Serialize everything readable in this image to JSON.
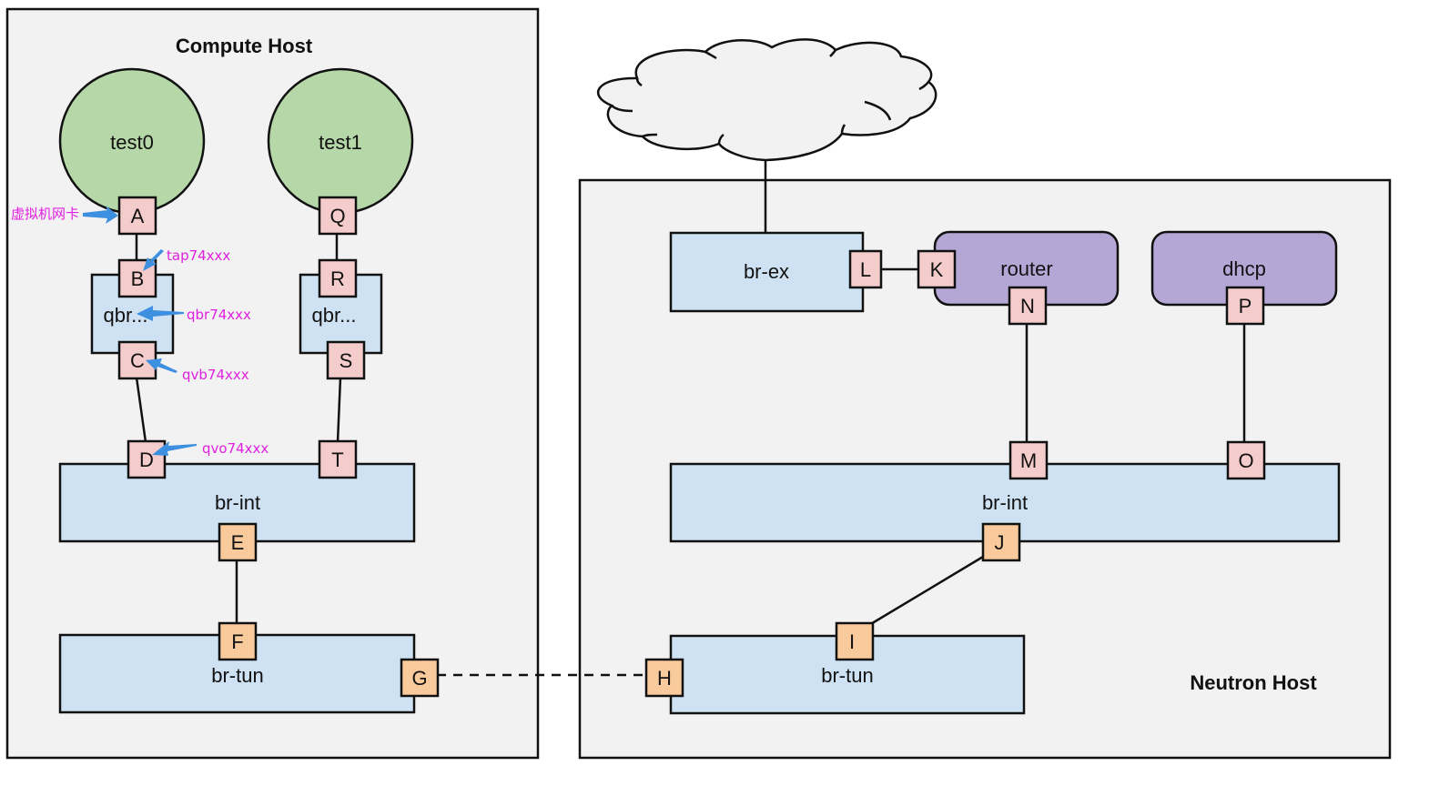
{
  "compute_host": {
    "title": "Compute Host",
    "vms": [
      {
        "name": "test0",
        "port": "A"
      },
      {
        "name": "test1",
        "port": "Q"
      }
    ],
    "qbr_bridges": [
      {
        "label": "qbr...",
        "top_port": "B",
        "bottom_port": "C"
      },
      {
        "label": "qbr...",
        "top_port": "R",
        "bottom_port": "S"
      }
    ],
    "br_int": {
      "label": "br-int",
      "ports": [
        "D",
        "T",
        "E"
      ]
    },
    "br_tun": {
      "label": "br-tun",
      "ports": [
        "F",
        "G"
      ]
    },
    "annotations": [
      {
        "text": "虚拟机网卡",
        "target": "A"
      },
      {
        "text": "tap74xxx",
        "target": "B"
      },
      {
        "text": "qbr74xxx",
        "target": "qbr"
      },
      {
        "text": "qvb74xxx",
        "target": "C"
      },
      {
        "text": "qvo74xxx",
        "target": "D"
      }
    ]
  },
  "neutron_host": {
    "title": "Neutron Host",
    "br_ex": {
      "label": "br-ex",
      "port": "L"
    },
    "router": {
      "label": "router",
      "ports": [
        "K",
        "N"
      ]
    },
    "dhcp": {
      "label": "dhcp",
      "port": "P"
    },
    "br_int": {
      "label": "br-int",
      "ports": [
        "M",
        "O",
        "J"
      ]
    },
    "br_tun": {
      "label": "br-tun",
      "ports": [
        "I",
        "H"
      ]
    }
  },
  "colors": {
    "host_bg": "#f2f2f2",
    "bridge": "#cfe2f3",
    "vm": "#b6d7a8",
    "namespace": "#b4a7d6",
    "port_pink": "#f4cccc",
    "port_orange": "#f9cb9c",
    "annotation_text": "#e020e0",
    "annotation_arrow": "#3d8fe0"
  }
}
